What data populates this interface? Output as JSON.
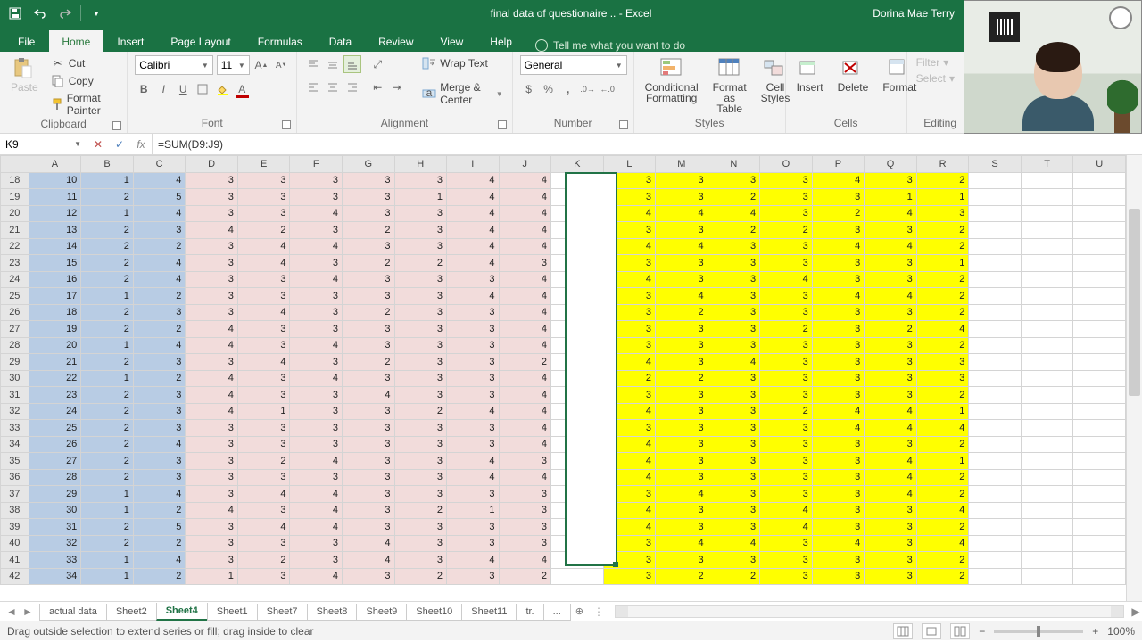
{
  "title": "final data of questionaire .. - Excel",
  "user": "Dorina Mae Terry",
  "menutabs": [
    "File",
    "Home",
    "Insert",
    "Page Layout",
    "Formulas",
    "Data",
    "Review",
    "View",
    "Help"
  ],
  "active_menutab": "Home",
  "tellme": "Tell me what you want to do",
  "clipboard": {
    "label": "Clipboard",
    "paste": "Paste",
    "cut": "Cut",
    "copy": "Copy",
    "fmt": "Format Painter"
  },
  "font": {
    "label": "Font",
    "name": "Calibri",
    "size": "11"
  },
  "alignment": {
    "label": "Alignment",
    "wrap": "Wrap Text",
    "merge": "Merge & Center"
  },
  "number": {
    "label": "Number",
    "format": "General"
  },
  "styles": {
    "label": "Styles",
    "cond": "Conditional Formatting",
    "table": "Format as Table",
    "cell": "Cell Styles"
  },
  "cells": {
    "label": "Cells",
    "insert": "Insert",
    "delete": "Delete",
    "format": "Format"
  },
  "editing": {
    "label": "Editing",
    "filter": "Filter",
    "select": "Select"
  },
  "namebox": "K9",
  "formula": "=SUM(D9:J9)",
  "columns": [
    "A",
    "B",
    "C",
    "D",
    "E",
    "F",
    "G",
    "H",
    "I",
    "J",
    "K",
    "L",
    "M",
    "N",
    "O",
    "P",
    "Q",
    "R",
    "S",
    "T",
    "U"
  ],
  "pink_cols": [
    "D",
    "E",
    "F",
    "G",
    "H",
    "I",
    "J"
  ],
  "yellow_cols": [
    "L",
    "M",
    "N",
    "O",
    "P",
    "Q",
    "R"
  ],
  "blue_cols": [
    "A",
    "B",
    "C"
  ],
  "rowstart": 18,
  "rows": [
    {
      "r": 18,
      "c": {
        "A": 10,
        "B": 1,
        "C": 4,
        "D": 3,
        "E": 3,
        "F": 3,
        "G": 3,
        "H": 3,
        "I": 4,
        "J": 4,
        "L": 3,
        "M": 3,
        "N": 3,
        "O": 3,
        "P": 4,
        "Q": 3,
        "R": 2
      }
    },
    {
      "r": 19,
      "c": {
        "A": 11,
        "B": 2,
        "C": 5,
        "D": 3,
        "E": 3,
        "F": 3,
        "G": 3,
        "H": 1,
        "I": 4,
        "J": 4,
        "L": 3,
        "M": 3,
        "N": 2,
        "O": 3,
        "P": 3,
        "Q": 1,
        "R": 1
      }
    },
    {
      "r": 20,
      "c": {
        "A": 12,
        "B": 1,
        "C": 4,
        "D": 3,
        "E": 3,
        "F": 4,
        "G": 3,
        "H": 3,
        "I": 4,
        "J": 4,
        "L": 4,
        "M": 4,
        "N": 4,
        "O": 3,
        "P": 2,
        "Q": 4,
        "R": 3
      }
    },
    {
      "r": 21,
      "c": {
        "A": 13,
        "B": 2,
        "C": 3,
        "D": 4,
        "E": 2,
        "F": 3,
        "G": 2,
        "H": 3,
        "I": 4,
        "J": 4,
        "L": 3,
        "M": 3,
        "N": 2,
        "O": 2,
        "P": 3,
        "Q": 3,
        "R": 2
      }
    },
    {
      "r": 22,
      "c": {
        "A": 14,
        "B": 2,
        "C": 2,
        "D": 3,
        "E": 4,
        "F": 4,
        "G": 3,
        "H": 3,
        "I": 4,
        "J": 4,
        "L": 4,
        "M": 4,
        "N": 3,
        "O": 3,
        "P": 4,
        "Q": 4,
        "R": 2
      }
    },
    {
      "r": 23,
      "c": {
        "A": 15,
        "B": 2,
        "C": 4,
        "D": 3,
        "E": 4,
        "F": 3,
        "G": 2,
        "H": 2,
        "I": 4,
        "J": 3,
        "L": 3,
        "M": 3,
        "N": 3,
        "O": 3,
        "P": 3,
        "Q": 3,
        "R": 1
      }
    },
    {
      "r": 24,
      "c": {
        "A": 16,
        "B": 2,
        "C": 4,
        "D": 3,
        "E": 3,
        "F": 4,
        "G": 3,
        "H": 3,
        "I": 3,
        "J": 4,
        "L": 4,
        "M": 3,
        "N": 3,
        "O": 4,
        "P": 3,
        "Q": 3,
        "R": 2
      }
    },
    {
      "r": 25,
      "c": {
        "A": 17,
        "B": 1,
        "C": 2,
        "D": 3,
        "E": 3,
        "F": 3,
        "G": 3,
        "H": 3,
        "I": 4,
        "J": 4,
        "L": 3,
        "M": 4,
        "N": 3,
        "O": 3,
        "P": 4,
        "Q": 4,
        "R": 2
      }
    },
    {
      "r": 26,
      "c": {
        "A": 18,
        "B": 2,
        "C": 3,
        "D": 3,
        "E": 4,
        "F": 3,
        "G": 2,
        "H": 3,
        "I": 3,
        "J": 4,
        "L": 3,
        "M": 2,
        "N": 3,
        "O": 3,
        "P": 3,
        "Q": 3,
        "R": 2
      }
    },
    {
      "r": 27,
      "c": {
        "A": 19,
        "B": 2,
        "C": 2,
        "D": 4,
        "E": 3,
        "F": 3,
        "G": 3,
        "H": 3,
        "I": 3,
        "J": 4,
        "L": 3,
        "M": 3,
        "N": 3,
        "O": 2,
        "P": 3,
        "Q": 2,
        "R": 4
      }
    },
    {
      "r": 28,
      "c": {
        "A": 20,
        "B": 1,
        "C": 4,
        "D": 4,
        "E": 3,
        "F": 4,
        "G": 3,
        "H": 3,
        "I": 3,
        "J": 4,
        "L": 3,
        "M": 3,
        "N": 3,
        "O": 3,
        "P": 3,
        "Q": 3,
        "R": 2
      }
    },
    {
      "r": 29,
      "c": {
        "A": 21,
        "B": 2,
        "C": 3,
        "D": 3,
        "E": 4,
        "F": 3,
        "G": 2,
        "H": 3,
        "I": 3,
        "J": 2,
        "L": 4,
        "M": 3,
        "N": 4,
        "O": 3,
        "P": 3,
        "Q": 3,
        "R": 3
      }
    },
    {
      "r": 30,
      "c": {
        "A": 22,
        "B": 1,
        "C": 2,
        "D": 4,
        "E": 3,
        "F": 4,
        "G": 3,
        "H": 3,
        "I": 3,
        "J": 4,
        "L": 2,
        "M": 2,
        "N": 3,
        "O": 3,
        "P": 3,
        "Q": 3,
        "R": 3
      }
    },
    {
      "r": 31,
      "c": {
        "A": 23,
        "B": 2,
        "C": 3,
        "D": 4,
        "E": 3,
        "F": 3,
        "G": 4,
        "H": 3,
        "I": 3,
        "J": 4,
        "L": 3,
        "M": 3,
        "N": 3,
        "O": 3,
        "P": 3,
        "Q": 3,
        "R": 2
      }
    },
    {
      "r": 32,
      "c": {
        "A": 24,
        "B": 2,
        "C": 3,
        "D": 4,
        "E": 1,
        "F": 3,
        "G": 3,
        "H": 2,
        "I": 4,
        "J": 4,
        "L": 4,
        "M": 3,
        "N": 3,
        "O": 2,
        "P": 4,
        "Q": 4,
        "R": 1
      }
    },
    {
      "r": 33,
      "c": {
        "A": 25,
        "B": 2,
        "C": 3,
        "D": 3,
        "E": 3,
        "F": 3,
        "G": 3,
        "H": 3,
        "I": 3,
        "J": 4,
        "L": 3,
        "M": 3,
        "N": 3,
        "O": 3,
        "P": 4,
        "Q": 4,
        "R": 4
      }
    },
    {
      "r": 34,
      "c": {
        "A": 26,
        "B": 2,
        "C": 4,
        "D": 3,
        "E": 3,
        "F": 3,
        "G": 3,
        "H": 3,
        "I": 3,
        "J": 4,
        "L": 4,
        "M": 3,
        "N": 3,
        "O": 3,
        "P": 3,
        "Q": 3,
        "R": 2
      }
    },
    {
      "r": 35,
      "c": {
        "A": 27,
        "B": 2,
        "C": 3,
        "D": 3,
        "E": 2,
        "F": 4,
        "G": 3,
        "H": 3,
        "I": 4,
        "J": 3,
        "L": 4,
        "M": 3,
        "N": 3,
        "O": 3,
        "P": 3,
        "Q": 4,
        "R": 1
      }
    },
    {
      "r": 36,
      "c": {
        "A": 28,
        "B": 2,
        "C": 3,
        "D": 3,
        "E": 3,
        "F": 3,
        "G": 3,
        "H": 3,
        "I": 4,
        "J": 4,
        "L": 4,
        "M": 3,
        "N": 3,
        "O": 3,
        "P": 3,
        "Q": 4,
        "R": 2
      }
    },
    {
      "r": 37,
      "c": {
        "A": 29,
        "B": 1,
        "C": 4,
        "D": 3,
        "E": 4,
        "F": 4,
        "G": 3,
        "H": 3,
        "I": 3,
        "J": 3,
        "L": 3,
        "M": 4,
        "N": 3,
        "O": 3,
        "P": 3,
        "Q": 4,
        "R": 2
      }
    },
    {
      "r": 38,
      "c": {
        "A": 30,
        "B": 1,
        "C": 2,
        "D": 4,
        "E": 3,
        "F": 4,
        "G": 3,
        "H": 2,
        "I": 1,
        "J": 3,
        "L": 4,
        "M": 3,
        "N": 3,
        "O": 4,
        "P": 3,
        "Q": 3,
        "R": 4
      }
    },
    {
      "r": 39,
      "c": {
        "A": 31,
        "B": 2,
        "C": 5,
        "D": 3,
        "E": 4,
        "F": 4,
        "G": 3,
        "H": 3,
        "I": 3,
        "J": 3,
        "L": 4,
        "M": 3,
        "N": 3,
        "O": 4,
        "P": 3,
        "Q": 3,
        "R": 2
      }
    },
    {
      "r": 40,
      "c": {
        "A": 32,
        "B": 2,
        "C": 2,
        "D": 3,
        "E": 3,
        "F": 3,
        "G": 4,
        "H": 3,
        "I": 3,
        "J": 3,
        "L": 3,
        "M": 4,
        "N": 4,
        "O": 3,
        "P": 4,
        "Q": 3,
        "R": 4
      }
    },
    {
      "r": 41,
      "c": {
        "A": 33,
        "B": 1,
        "C": 4,
        "D": 3,
        "E": 2,
        "F": 3,
        "G": 4,
        "H": 3,
        "I": 4,
        "J": 4,
        "L": 3,
        "M": 3,
        "N": 3,
        "O": 3,
        "P": 3,
        "Q": 3,
        "R": 2
      }
    },
    {
      "r": 42,
      "c": {
        "A": 34,
        "B": 1,
        "C": 2,
        "D": 1,
        "E": 3,
        "F": 4,
        "G": 3,
        "H": 2,
        "I": 3,
        "J": 2,
        "L": 3,
        "M": 2,
        "N": 2,
        "O": 3,
        "P": 3,
        "Q": 3,
        "R": 2
      }
    }
  ],
  "sheet_tabs": [
    "actual data",
    "Sheet2",
    "Sheet4",
    "Sheet1",
    "Sheet7",
    "Sheet8",
    "Sheet9",
    "Sheet10",
    "Sheet11",
    "tr.",
    "..."
  ],
  "active_sheet": "Sheet4",
  "status": "Drag outside selection to extend series or fill; drag inside to clear",
  "zoom": "100%",
  "colors": {
    "green": "#217346"
  }
}
